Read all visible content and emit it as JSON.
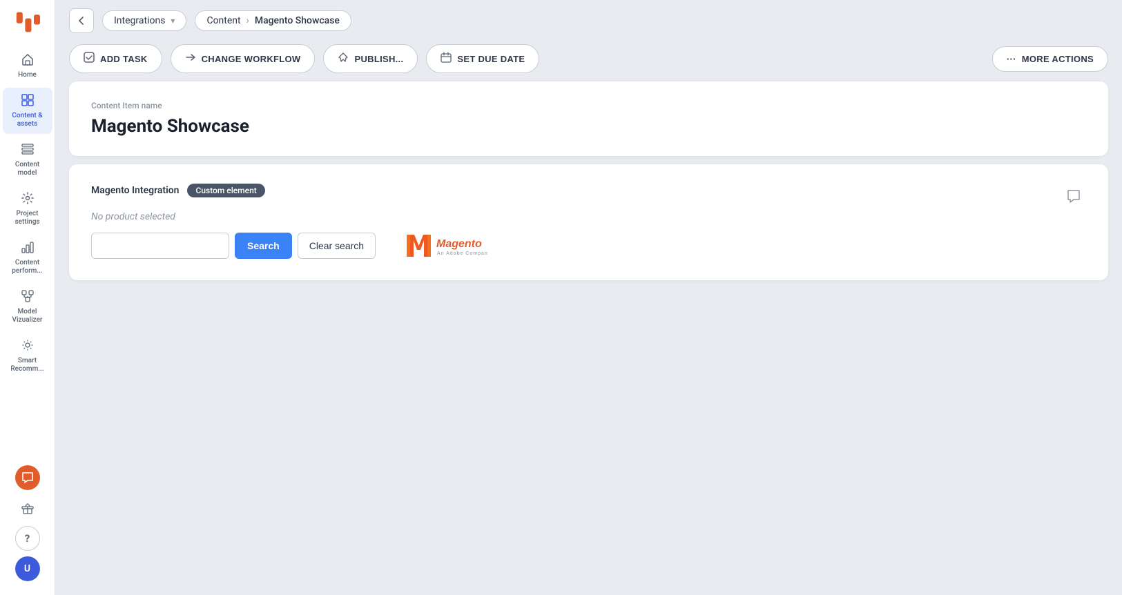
{
  "logo": {
    "alt": "Amplience logo"
  },
  "sidebar": {
    "items": [
      {
        "id": "home",
        "label": "Home",
        "icon": "🏠"
      },
      {
        "id": "content-assets",
        "label": "Content & assets",
        "icon": "⊞",
        "active": true
      },
      {
        "id": "content-model",
        "label": "Content model",
        "icon": "⊟"
      },
      {
        "id": "project-settings",
        "label": "Project settings",
        "icon": "⚙"
      },
      {
        "id": "content-perform",
        "label": "Content perform...",
        "icon": "📊"
      },
      {
        "id": "model-vizualizer",
        "label": "Model Vizualizer",
        "icon": "⊡"
      },
      {
        "id": "smart-recomm",
        "label": "Smart Recomm...",
        "icon": "✦"
      }
    ],
    "bottom": [
      {
        "id": "chat",
        "icon": "💬",
        "type": "orange"
      },
      {
        "id": "gift",
        "icon": "🎁",
        "type": "normal"
      },
      {
        "id": "help",
        "icon": "?",
        "type": "normal"
      },
      {
        "id": "avatar",
        "label": "U",
        "type": "avatar"
      }
    ]
  },
  "topbar": {
    "back_label": "‹",
    "integrations_label": "Integrations",
    "breadcrumb_content": "Content",
    "breadcrumb_separator": "›",
    "breadcrumb_current": "Magento Showcase"
  },
  "actions": {
    "add_task": "ADD TASK",
    "change_workflow": "CHANGE WORKFLOW",
    "publish": "PUBLISH...",
    "set_due_date": "SET DUE DATE",
    "more_actions": "MORE ACTIONS",
    "more_dots": "···"
  },
  "content": {
    "item_label": "Content Item name",
    "item_title": "Magento Showcase"
  },
  "integration": {
    "label": "Magento Integration",
    "badge": "Custom element",
    "no_product": "No product selected",
    "search_placeholder": "",
    "search_btn": "Search",
    "clear_btn": "Clear search",
    "magento_name": "Magento",
    "magento_sub": "An Adobe Company"
  }
}
